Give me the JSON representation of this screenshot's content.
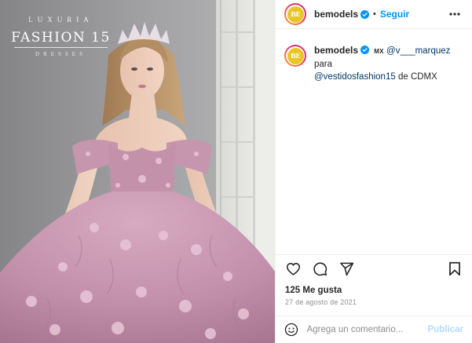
{
  "post": {
    "photo": {
      "alt": "Model in a pink quinceañera gown",
      "brand_top": "LUXURIA",
      "brand_main": "FASHION 15",
      "brand_sub": "DRESSES"
    },
    "header": {
      "username": "bemodels",
      "avatar_text": "BE",
      "dot": "•",
      "follow_label": "Seguir",
      "more_icon": "more-horizontal-icon"
    },
    "caption": {
      "username": "bemodels",
      "flag": "MX",
      "mention1": "@v___marquez",
      "word_para": "para",
      "mention2": "@vestidosfashion15",
      "tail": "de CDMX"
    },
    "actions": {
      "like_icon": "heart-icon",
      "comment_icon": "comment-icon",
      "share_icon": "send-icon",
      "save_icon": "bookmark-icon"
    },
    "likes": "125 Me gusta",
    "date": "27 de agosto de 2021",
    "comment_box": {
      "emoji_icon": "emoji-icon",
      "placeholder": "Agrega un comentario...",
      "publish_label": "Publicar"
    },
    "colors": {
      "link_blue": "#0095f6",
      "mention_blue": "#00376b",
      "publish_disabled": "#b3dbff",
      "dress_pink": "#c896b2",
      "avatar_gold": "#e9c52a"
    }
  }
}
